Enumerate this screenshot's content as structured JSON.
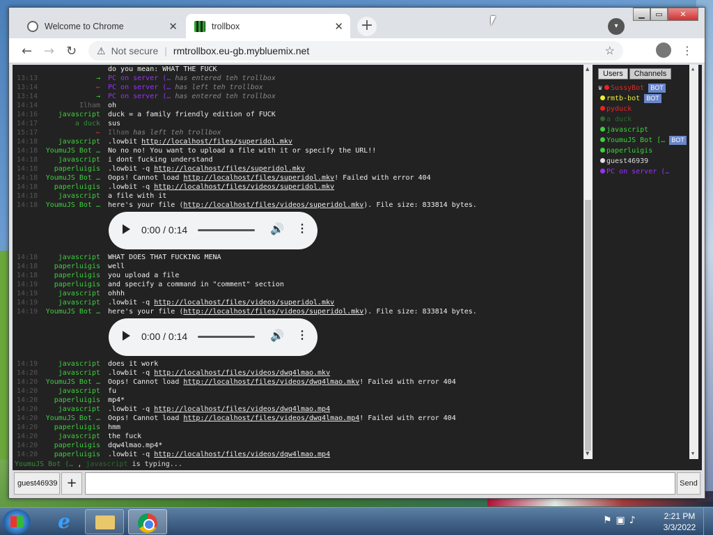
{
  "browser": {
    "tabs": [
      {
        "title": "Welcome to Chrome",
        "close": "✕"
      },
      {
        "title": "trollbox",
        "close": "✕"
      }
    ],
    "new_tab": "+",
    "window_controls": {
      "minimize": "▁",
      "maximize": "▭",
      "close": "✕"
    },
    "security_label": "Not secure",
    "url": "rmtrollbox.eu-gb.mybluemix.net"
  },
  "chat": {
    "messages": [
      {
        "ts": "",
        "nick": "",
        "nick_class": "",
        "text": "do you mean: WHAT THE FUCK"
      },
      {
        "ts": "13:13",
        "nick": "→",
        "nick_class": "c-js",
        "sys": true,
        "actor": "PC on server (…",
        "text": "has entered teh trollbox"
      },
      {
        "ts": "13:14",
        "nick": "←",
        "nick_class": "c-arrow",
        "sys": true,
        "actor": "PC on server (…",
        "text": "has left teh trollbox"
      },
      {
        "ts": "13:14",
        "nick": "→",
        "nick_class": "c-js",
        "sys": true,
        "actor": "PC on server (…",
        "text": "has entered teh trollbox"
      },
      {
        "ts": "14:14",
        "nick": "Ilham",
        "nick_class": "c-ilham",
        "text": "oh"
      },
      {
        "ts": "14:16",
        "nick": "javascript",
        "nick_class": "c-js",
        "text": "duck = a family friendly edition of FUCK"
      },
      {
        "ts": "14:17",
        "nick": "a duck",
        "nick_class": "c-duck",
        "text": "sus"
      },
      {
        "ts": "15:17",
        "nick": "←",
        "nick_class": "c-arrow",
        "sys": true,
        "actor": "Ilham",
        "text": "has left teh trollbox"
      },
      {
        "ts": "14:18",
        "nick": "javascript",
        "nick_class": "c-js",
        "text": ".lowbit ",
        "link": "http://localhost/files/superidol.mkv"
      },
      {
        "ts": "14:18",
        "nick": "YoumuJS Bot …",
        "nick_class": "c-youmu",
        "text": "No no no! You want to upload a file with it or specify the URL!!"
      },
      {
        "ts": "14:18",
        "nick": "javascript",
        "nick_class": "c-js",
        "text": "i dont fucking understand"
      },
      {
        "ts": "14:18",
        "nick": "paperluigis",
        "nick_class": "c-paper",
        "text": ".lowbit -q ",
        "link": "http://localhost/files/superidol.mkv"
      },
      {
        "ts": "14:18",
        "nick": "YoumuJS Bot …",
        "nick_class": "c-youmu",
        "text": "Oops! Cannot load ",
        "link": "http://localhost/files/superidol.mkv",
        "after": "! Failed with error 404"
      },
      {
        "ts": "14:18",
        "nick": "paperluigis",
        "nick_class": "c-paper",
        "text": ".lowbit -q ",
        "link": "http://localhost/files/videos/superidol.mkv"
      },
      {
        "ts": "14:18",
        "nick": "javascript",
        "nick_class": "c-js",
        "text": "a file with it"
      },
      {
        "ts": "14:18",
        "nick": "YoumuJS Bot …",
        "nick_class": "c-youmu",
        "text": "here's your file (",
        "link": "http://localhost/files/videos/superidol.mkv",
        "after": "). File size: 833814 bytes.",
        "audio": true
      },
      {
        "ts": "14:18",
        "nick": "javascript",
        "nick_class": "c-js",
        "text": "WHAT DOES THAT FUCKING MENA"
      },
      {
        "ts": "14:18",
        "nick": "paperluigis",
        "nick_class": "c-paper",
        "text": "well"
      },
      {
        "ts": "14:18",
        "nick": "paperluigis",
        "nick_class": "c-paper",
        "text": "you upload a file"
      },
      {
        "ts": "14:19",
        "nick": "paperluigis",
        "nick_class": "c-paper",
        "text": "and specify a command in \"comment\" section"
      },
      {
        "ts": "14:19",
        "nick": "javascript",
        "nick_class": "c-js",
        "text": "ohhh"
      },
      {
        "ts": "14:19",
        "nick": "javascript",
        "nick_class": "c-js",
        "text": ".lowbit -q ",
        "link": "http://localhost/files/videos/superidol.mkv"
      },
      {
        "ts": "14:19",
        "nick": "YoumuJS Bot …",
        "nick_class": "c-youmu",
        "text": "here's your file (",
        "link": "http://localhost/files/videos/superidol.mkv",
        "after": "). File size: 833814 bytes.",
        "audio": true
      },
      {
        "ts": "14:19",
        "nick": "javascript",
        "nick_class": "c-js",
        "text": "does it work"
      },
      {
        "ts": "14:20",
        "nick": "javascript",
        "nick_class": "c-js",
        "text": ".lowbit -q ",
        "link": "http://localhost/files/videos/dwq4lmao.mkv"
      },
      {
        "ts": "14:20",
        "nick": "YoumuJS Bot …",
        "nick_class": "c-youmu",
        "text": "Oops! Cannot load ",
        "link": "http://localhost/files/videos/dwq4lmao.mkv",
        "after": "! Failed with error 404"
      },
      {
        "ts": "14:20",
        "nick": "javascript",
        "nick_class": "c-js",
        "text": "fu"
      },
      {
        "ts": "14:20",
        "nick": "paperluigis",
        "nick_class": "c-paper",
        "text": "mp4*"
      },
      {
        "ts": "14:20",
        "nick": "javascript",
        "nick_class": "c-js",
        "text": ".lowbit -q ",
        "link": "http://localhost/files/videos/dwq4lmao.mp4"
      },
      {
        "ts": "14:20",
        "nick": "YoumuJS Bot …",
        "nick_class": "c-youmu",
        "text": "Oops! Cannot load ",
        "link": "http://localhost/files/videos/dwq4lmao.mp4",
        "after": "! Failed with error 404"
      },
      {
        "ts": "14:20",
        "nick": "paperluigis",
        "nick_class": "c-paper",
        "text": "hmm"
      },
      {
        "ts": "14:20",
        "nick": "javascript",
        "nick_class": "c-js",
        "text": "the fuck"
      },
      {
        "ts": "14:20",
        "nick": "paperluigis",
        "nick_class": "c-paper",
        "text": "dqw4lmao.mp4*"
      },
      {
        "ts": "14:20",
        "nick": "paperluigis",
        "nick_class": "c-paper",
        "text": ".lowbit -q ",
        "link": "http://localhost/files/videos/dqw4lmao.mp4"
      }
    ],
    "audio_player": {
      "time": "0:00 / 0:14",
      "play": "▶",
      "volume": "🔊",
      "more": "⋮"
    },
    "typing": {
      "nick1": "YoumuJS Bot (…",
      "sep": " , ",
      "nick2": "javascript",
      "text": " is typing..."
    }
  },
  "sidebar": {
    "tabs": [
      "Users",
      "Channels"
    ],
    "users": [
      {
        "name": "SussyBot",
        "color": "#e22",
        "bot": true,
        "crown": true
      },
      {
        "name": "rmtb-bot",
        "color": "#ee3",
        "bot": true
      },
      {
        "name": "pyduck",
        "color": "#e22"
      },
      {
        "name": "a duck",
        "color": "#2a6a2a"
      },
      {
        "name": "javascript",
        "color": "#3cd13c"
      },
      {
        "name": "YoumuJS Bot […",
        "color": "#3cd13c",
        "bot": true
      },
      {
        "name": "paperluigis",
        "color": "#3cd13c"
      },
      {
        "name": "guest46939",
        "color": "#ddd"
      },
      {
        "name": "PC on server (…",
        "color": "#9b30ff"
      }
    ],
    "bot_label": "BOT"
  },
  "input": {
    "username": "guest46939",
    "plus": "+",
    "send": "Send"
  },
  "taskbar": {
    "time": "2:21 PM",
    "date": "3/3/2022"
  }
}
